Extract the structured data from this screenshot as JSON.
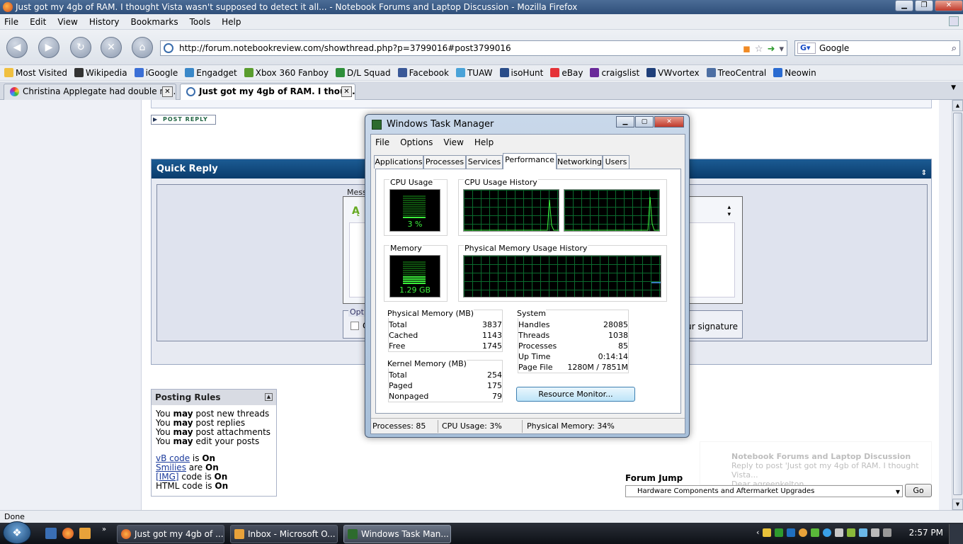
{
  "browser": {
    "window_title": "Just got my 4gb of RAM. I thought Vista wasn't supposed to detect it all... - Notebook Forums and Laptop Discussion - Mozilla Firefox",
    "menu": [
      "File",
      "Edit",
      "View",
      "History",
      "Bookmarks",
      "Tools",
      "Help"
    ],
    "url": "http://forum.notebookreview.com/showthread.php?p=3799016#post3799016",
    "search_engine": "Google",
    "bookmarks": [
      {
        "label": "Most Visited",
        "icon": "folder-icon",
        "color": "#f0c040"
      },
      {
        "label": "Wikipedia",
        "icon": "wikipedia-icon",
        "color": "#333333"
      },
      {
        "label": "iGoogle",
        "icon": "igoogle-icon",
        "color": "#3b6fd6"
      },
      {
        "label": "Engadget",
        "icon": "engadget-icon",
        "color": "#3a88c8"
      },
      {
        "label": "Xbox 360 Fanboy",
        "icon": "xbox-icon",
        "color": "#5a9d2e"
      },
      {
        "label": "D/L Squad",
        "icon": "dlsquad-icon",
        "color": "#2e8f3a"
      },
      {
        "label": "Facebook",
        "icon": "facebook-icon",
        "color": "#3b5998"
      },
      {
        "label": "TUAW",
        "icon": "tuaw-icon",
        "color": "#4aa3d8"
      },
      {
        "label": "isoHunt",
        "icon": "isohunt-icon",
        "color": "#2a4d8a"
      },
      {
        "label": "eBay",
        "icon": "ebay-icon",
        "color": "#e53238"
      },
      {
        "label": "craigslist",
        "icon": "peace-icon",
        "color": "#6a2a9a"
      },
      {
        "label": "VWvortex",
        "icon": "vwvortex-icon",
        "color": "#1f3f7a"
      },
      {
        "label": "TreoCentral",
        "icon": "treocentral-icon",
        "color": "#4d6fa3"
      },
      {
        "label": "Neowin",
        "icon": "neowin-icon",
        "color": "#2a6bd1"
      }
    ],
    "tabs": [
      {
        "label": "Christina Applegate had double ma...",
        "active": false
      },
      {
        "label": "Just got my 4gb of RAM. I thoug...",
        "active": true
      }
    ],
    "status": "Done"
  },
  "page": {
    "post_reply": "POST REPLY",
    "quick_reply": {
      "title": "Quick Reply",
      "message_label": "Messa",
      "options_legend": "Optio",
      "checkbox_letter": "C",
      "signature_text": "ur signature"
    },
    "posting_rules": {
      "title": "Posting Rules",
      "lines": [
        {
          "pre": "You ",
          "bold": "may",
          "post": " post new threads"
        },
        {
          "pre": "You ",
          "bold": "may",
          "post": " post replies"
        },
        {
          "pre": "You ",
          "bold": "may",
          "post": " post attachments"
        },
        {
          "pre": "You ",
          "bold": "may",
          "post": " edit your posts"
        }
      ],
      "codes": [
        {
          "link": "vB code",
          "mid": " is ",
          "state": "On"
        },
        {
          "link": "Smilies",
          "mid": " are ",
          "state": "On"
        },
        {
          "link": "[IMG]",
          "mid": " code is ",
          "state": "On"
        },
        {
          "link": "",
          "mid": "HTML code is ",
          "state": "On"
        }
      ]
    },
    "forum_jump": {
      "label": "Forum Jump",
      "selected": "Hardware Components and Aftermarket Upgrades",
      "go": "Go"
    },
    "notification": {
      "title": "Notebook Forums and Laptop Discussion",
      "line1": "Reply to post 'Just got my 4gb of RAM. I thought Vista...",
      "line2": "Dear agreenkelton"
    }
  },
  "task_manager": {
    "title": "Windows Task Manager",
    "menu": [
      "File",
      "Options",
      "View",
      "Help"
    ],
    "tabs": [
      "Applications",
      "Processes",
      "Services",
      "Performance",
      "Networking",
      "Users"
    ],
    "active_tab": "Performance",
    "cpu_usage": {
      "title": "CPU Usage",
      "value": "3 %",
      "fraction": 0.03
    },
    "cpu_history": {
      "title": "CPU Usage History"
    },
    "memory": {
      "title": "Memory",
      "value": "1.29 GB",
      "fraction": 0.34
    },
    "mem_history": {
      "title": "Physical Memory Usage History"
    },
    "physical_memory": {
      "title": "Physical Memory (MB)",
      "rows": [
        [
          "Total",
          "3837"
        ],
        [
          "Cached",
          "1143"
        ],
        [
          "Free",
          "1745"
        ]
      ]
    },
    "kernel_memory": {
      "title": "Kernel Memory (MB)",
      "rows": [
        [
          "Total",
          "254"
        ],
        [
          "Paged",
          "175"
        ],
        [
          "Nonpaged",
          "79"
        ]
      ]
    },
    "system": {
      "title": "System",
      "rows": [
        [
          "Handles",
          "28085"
        ],
        [
          "Threads",
          "1038"
        ],
        [
          "Processes",
          "85"
        ],
        [
          "Up Time",
          "0:14:14"
        ],
        [
          "Page File",
          "1280M / 7851M"
        ]
      ]
    },
    "resource_monitor": "Resource Monitor...",
    "status": {
      "processes": "Processes: 85",
      "cpu": "CPU Usage: 3%",
      "memory": "Physical Memory: 34%"
    }
  },
  "taskbar": {
    "start": "❖",
    "buttons": [
      {
        "label": "Just got my 4gb of ...",
        "icon": "firefox-icon",
        "active": false
      },
      {
        "label": "Inbox - Microsoft O...",
        "icon": "outlook-icon",
        "active": false
      },
      {
        "label": "Windows Task Man...",
        "icon": "taskmanager-icon",
        "active": true
      }
    ],
    "clock": "2:57 PM"
  }
}
